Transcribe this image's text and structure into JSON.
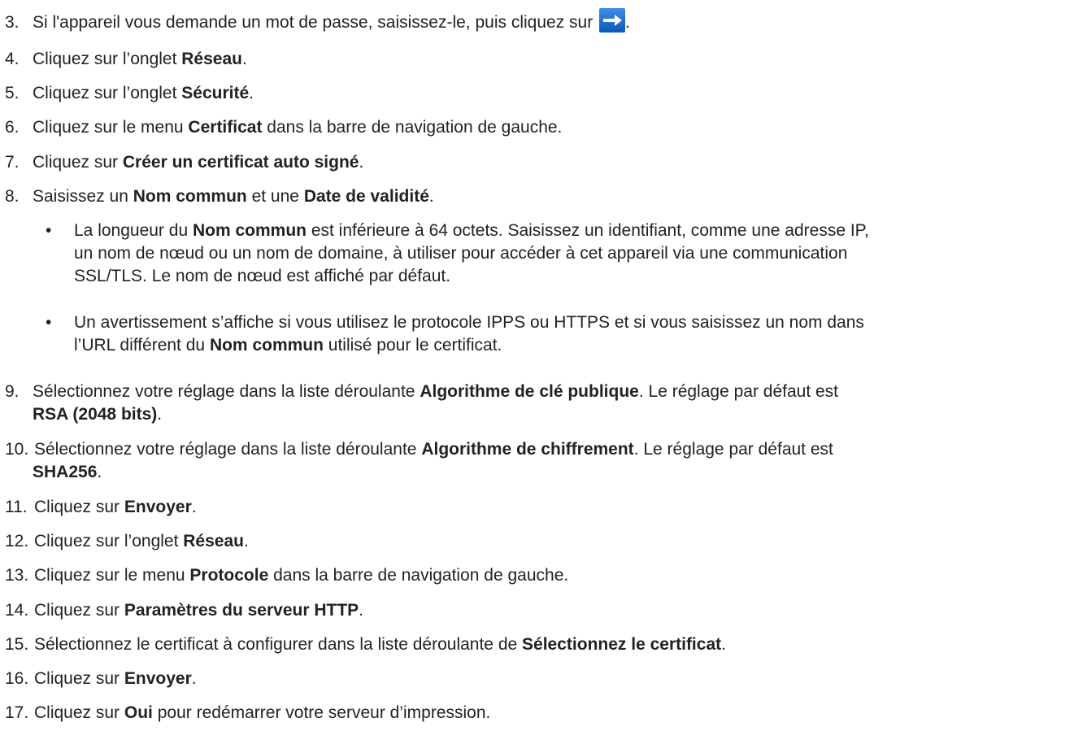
{
  "steps": [
    {
      "num": "3.",
      "parts": [
        "Si l'appareil vous demande un mot de passe, saisissez-le, puis cliquez sur",
        "."
      ]
    },
    {
      "num": "4.",
      "pre": "Cliquez sur l’onglet ",
      "b1": "Réseau",
      "post": "."
    },
    {
      "num": "5.",
      "pre": "Cliquez sur l’onglet ",
      "b1": "Sécurité",
      "post": "."
    },
    {
      "num": "6.",
      "pre": "Cliquez sur le menu ",
      "b1": "Certificat",
      "post": " dans la barre de navigation de gauche."
    },
    {
      "num": "7.",
      "pre": "Cliquez sur ",
      "b1": "Créer un certificat auto signé",
      "post": "."
    },
    {
      "num": "8.",
      "pre": "Saisissez un ",
      "b1": "Nom commun",
      "mid": " et une ",
      "b2": "Date de validité",
      "post": "."
    },
    {
      "num": "9.",
      "pre": "Sélectionnez votre réglage dans la liste déroulante ",
      "b1": "Algorithme de clé publique",
      "mid": ". Le réglage par défaut est",
      "b2": "RSA (2048 bits)",
      "post": "."
    },
    {
      "num": "10.",
      "pre": "Sélectionnez votre réglage dans la liste déroulante ",
      "b1": "Algorithme de chiffrement",
      "mid": ". Le réglage par défaut est",
      "b2": "SHA256",
      "post": "."
    },
    {
      "num": "11.",
      "pre": "Cliquez sur ",
      "b1": "Envoyer",
      "post": "."
    },
    {
      "num": "12.",
      "pre": "Cliquez sur l’onglet ",
      "b1": "Réseau",
      "post": "."
    },
    {
      "num": "13.",
      "pre": "Cliquez sur le menu ",
      "b1": "Protocole",
      "post": " dans la barre de navigation de gauche."
    },
    {
      "num": "14.",
      "pre": "Cliquez sur ",
      "b1": "Paramètres du serveur HTTP",
      "post": "."
    },
    {
      "num": "15.",
      "pre": "Sélectionnez le certificat à configurer dans la liste déroulante de ",
      "b1": "Sélectionnez le certificat",
      "post": "."
    },
    {
      "num": "16.",
      "pre": "Cliquez sur ",
      "b1": "Envoyer",
      "post": "."
    },
    {
      "num": "17.",
      "pre": "Cliquez sur ",
      "b1": "Oui",
      "post": " pour redémarrer votre serveur d’impression."
    }
  ],
  "bullets": [
    {
      "dot": "•",
      "pre": "La longueur du ",
      "b1": "Nom commun",
      "post1": " est inférieure à 64 octets. Saisissez un identifiant, comme une adresse IP,",
      "line2": "un nom de nœud ou un nom de domaine, à utiliser pour accéder à cet appareil via une communication",
      "line3": "SSL/TLS. Le nom de nœud est affiché par défaut."
    },
    {
      "dot": "•",
      "line1": "Un avertissement s’affiche si vous utilisez le protocole IPPS ou HTTPS et si vous saisissez un nom dans",
      "pre2": "l’URL différent du ",
      "b1": "Nom commun",
      "post2": " utilisé pour le certificat."
    }
  ],
  "icons": {
    "go_arrow": "arrow-right-icon",
    "go_bg": "#1a6fd1"
  }
}
